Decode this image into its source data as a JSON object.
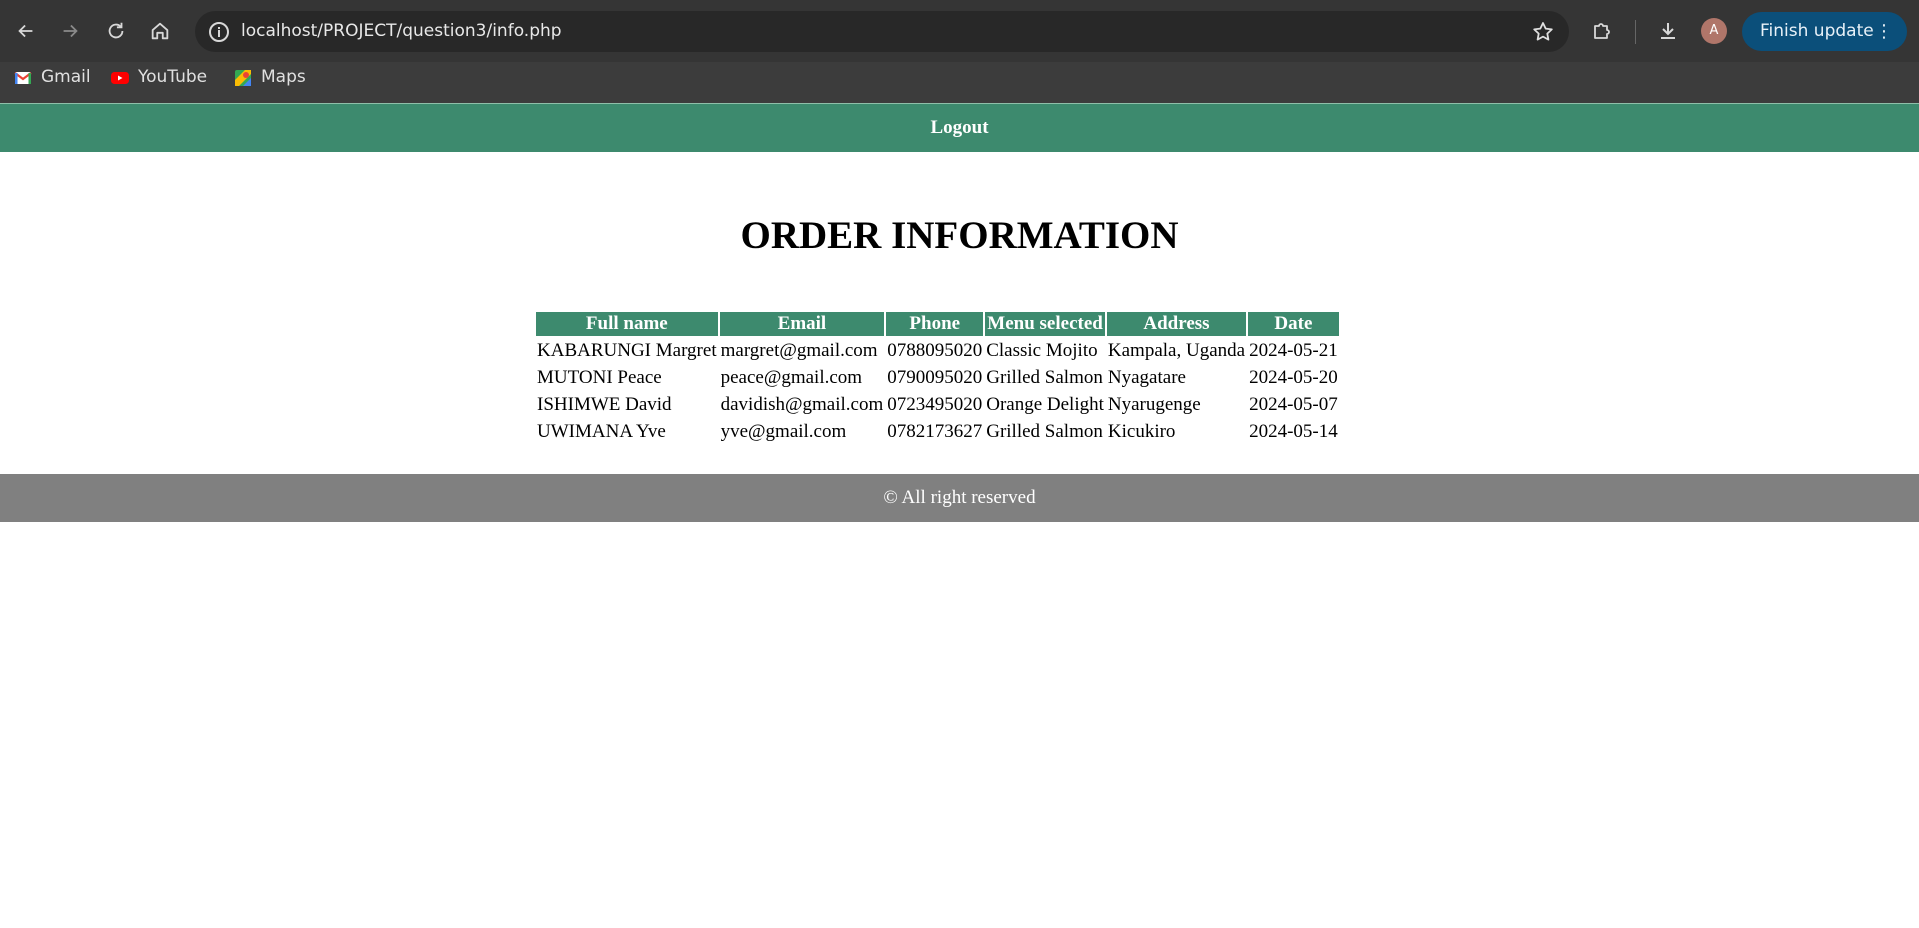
{
  "browser": {
    "url": "localhost/PROJECT/question3/info.php",
    "finish_update_label": "Finish update",
    "profile_initial": "A",
    "bookmarks": [
      {
        "label": "Gmail",
        "icon": "gmail-icon"
      },
      {
        "label": "YouTube",
        "icon": "youtube-icon"
      },
      {
        "label": "Maps",
        "icon": "maps-icon"
      }
    ]
  },
  "nav": {
    "logout_label": "Logout"
  },
  "page": {
    "title": "ORDER INFORMATION"
  },
  "table": {
    "headers": [
      "Full name",
      "Email",
      "Phone",
      "Menu selected",
      "Address",
      "Date"
    ],
    "rows": [
      [
        "KABARUNGI Margret",
        "margret@gmail.com",
        "0788095020",
        "Classic Mojito",
        "Kampala, Uganda",
        "2024-05-21"
      ],
      [
        "MUTONI Peace",
        "peace@gmail.com",
        "0790095020",
        "Grilled Salmon",
        "Nyagatare",
        "2024-05-20"
      ],
      [
        "ISHIMWE David",
        "davidish@gmail.com",
        "0723495020",
        "Orange Delight",
        "Nyarugenge",
        "2024-05-07"
      ],
      [
        "UWIMANA Yve",
        "yve@gmail.com",
        "0782173627",
        "Grilled Salmon",
        "Kicukiro",
        "2024-05-14"
      ]
    ]
  },
  "footer": {
    "text": "© All right reserved"
  },
  "colors": {
    "accent_green": "#3d8a6e",
    "footer_gray": "#808080",
    "update_blue": "#0b4f7a"
  }
}
